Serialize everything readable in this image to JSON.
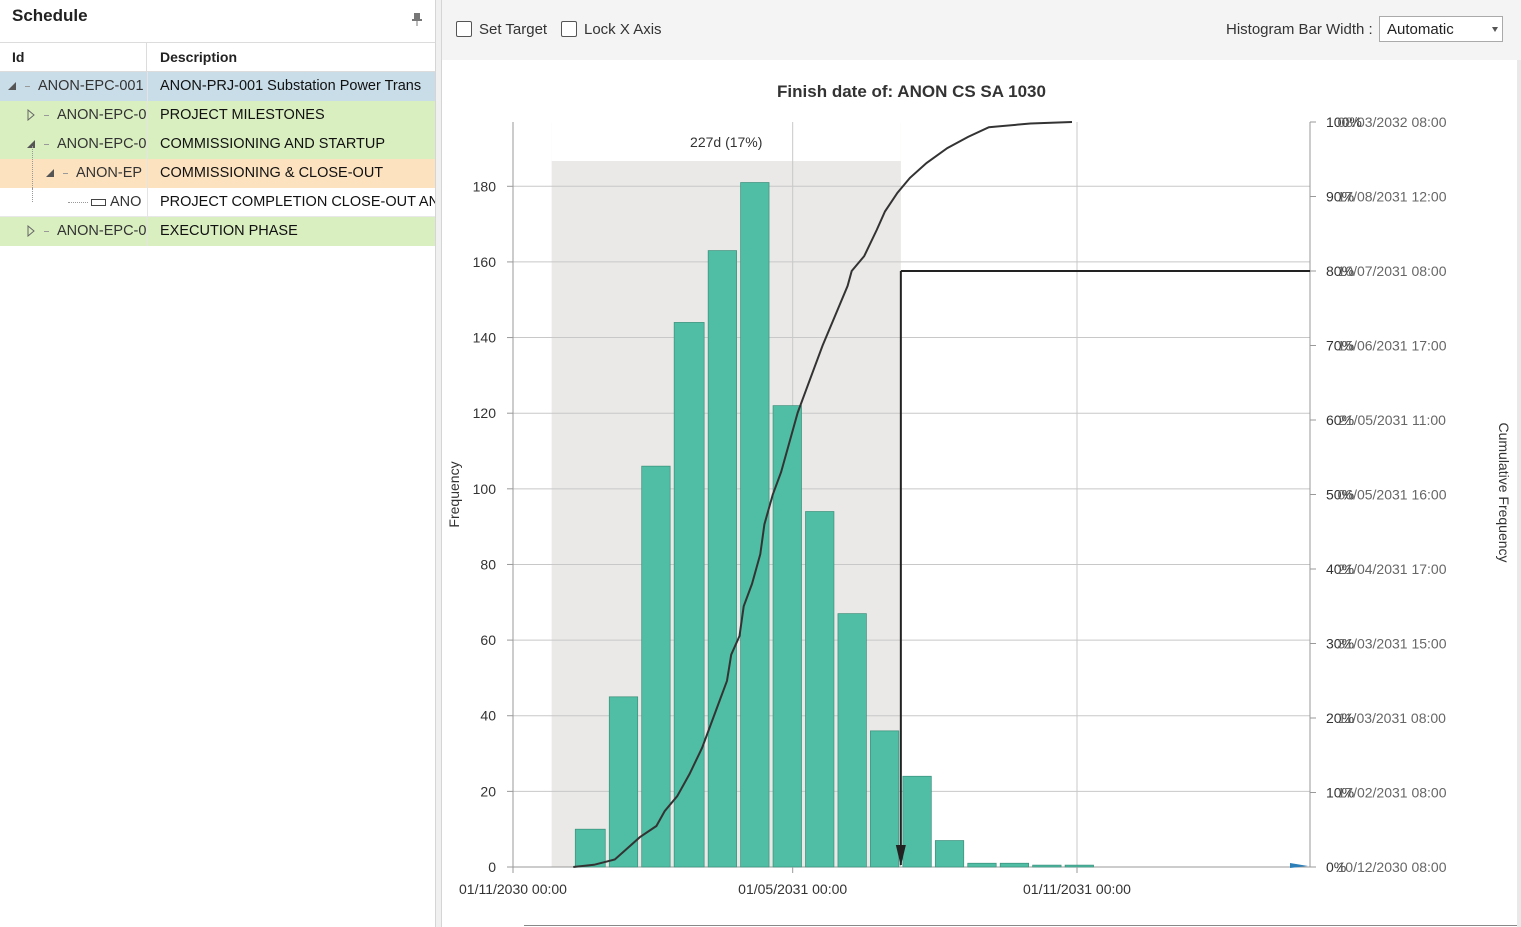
{
  "schedule": {
    "title": "Schedule",
    "pin_icon": "pin-icon",
    "columns": {
      "id": "Id",
      "description": "Description"
    },
    "rows": [
      {
        "id": "ANON-EPC-001",
        "description": "ANON-PRJ-001 Substation Power Trans",
        "level": 0,
        "state": "expanded",
        "color": "#c9dde8"
      },
      {
        "id": "ANON-EPC-0",
        "description": "PROJECT MILESTONES",
        "level": 1,
        "state": "collapsed",
        "color": "#d9efc0"
      },
      {
        "id": "ANON-EPC-0",
        "description": "COMMISSIONING AND STARTUP",
        "level": 1,
        "state": "expanded",
        "color": "#d9efc0"
      },
      {
        "id": "ANON-EP",
        "description": "COMMISSIONING & CLOSE-OUT",
        "level": 2,
        "state": "expanded",
        "color": "#fde2c0"
      },
      {
        "id": "ANO",
        "description": "PROJECT COMPLETION CLOSE-OUT AN",
        "level": 3,
        "state": "leaf",
        "color": "#ffffff"
      },
      {
        "id": "ANON-EPC-0",
        "description": "EXECUTION PHASE",
        "level": 1,
        "state": "collapsed",
        "color": "#d9efc0"
      }
    ]
  },
  "toolbar": {
    "set_target_label": "Set Target",
    "set_target_checked": false,
    "lock_x_label": "Lock X Axis",
    "lock_x_checked": false,
    "histogram_bar_width_label": "Histogram Bar Width :",
    "histogram_bar_width_value": "Automatic"
  },
  "chart_data": {
    "type": "bar",
    "title": "Finish date of: ANON CS SA 1030",
    "ylabel": "Frequency",
    "y2label": "Cumulative Frequency",
    "ylim": [
      0,
      197
    ],
    "y_ticks": [
      0,
      20,
      40,
      60,
      80,
      100,
      120,
      140,
      160,
      180
    ],
    "x_tick_labels": [
      "01/11/2030 00:00",
      "01/05/2031 00:00",
      "01/11/2031 00:00"
    ],
    "x_tick_positions": [
      "2030-11-01",
      "2031-05-01",
      "2031-11-01"
    ],
    "colors": {
      "bar": "#4fbea4",
      "bar_stroke": "#3a8f7a",
      "highlight_region": "#ebe9e7",
      "curve": "#333333",
      "grid": "#c8c8c8"
    },
    "bins": [
      {
        "start": "2030-12-10",
        "end": "2030-12-31",
        "frequency": 10
      },
      {
        "start": "2031-01-01",
        "end": "2031-01-21",
        "frequency": 45
      },
      {
        "start": "2031-01-22",
        "end": "2031-02-11",
        "frequency": 106
      },
      {
        "start": "2031-02-12",
        "end": "2031-03-05",
        "frequency": 144
      },
      {
        "start": "2031-03-06",
        "end": "2031-03-26",
        "frequency": 163
      },
      {
        "start": "2031-03-27",
        "end": "2031-04-16",
        "frequency": 181
      },
      {
        "start": "2031-04-17",
        "end": "2031-05-07",
        "frequency": 122
      },
      {
        "start": "2031-05-08",
        "end": "2031-05-28",
        "frequency": 94
      },
      {
        "start": "2031-05-29",
        "end": "2031-06-18",
        "frequency": 67
      },
      {
        "start": "2031-06-19",
        "end": "2031-07-09",
        "frequency": 36
      },
      {
        "start": "2031-07-10",
        "end": "2031-07-30",
        "frequency": 24
      },
      {
        "start": "2031-07-31",
        "end": "2031-08-20",
        "frequency": 7
      },
      {
        "start": "2031-08-21",
        "end": "2031-09-10",
        "frequency": 1
      },
      {
        "start": "2031-09-11",
        "end": "2031-10-01",
        "frequency": 1
      },
      {
        "start": "2031-10-02",
        "end": "2031-10-22",
        "frequency": 0.5
      },
      {
        "start": "2031-10-23",
        "end": "2031-11-12",
        "frequency": 0.5
      }
    ],
    "cumulative_axis": [
      {
        "percent": "0%",
        "date": "10/12/2030 08:00"
      },
      {
        "percent": "10%",
        "date": "17/02/2031 08:00"
      },
      {
        "percent": "20%",
        "date": "11/03/2031 08:00"
      },
      {
        "percent": "30%",
        "date": "31/03/2031 15:00"
      },
      {
        "percent": "40%",
        "date": "21/04/2031 17:00"
      },
      {
        "percent": "50%",
        "date": "06/05/2031 16:00"
      },
      {
        "percent": "60%",
        "date": "21/05/2031 11:00"
      },
      {
        "percent": "70%",
        "date": "15/06/2031 17:00"
      },
      {
        "percent": "80%",
        "date": "10/07/2031 08:00"
      },
      {
        "percent": "90%",
        "date": "17/08/2031 12:00"
      },
      {
        "percent": "100%",
        "date": "08/03/2032 08:00"
      }
    ],
    "cumulative_curve": [
      [
        0,
        0
      ],
      [
        0.05,
        0.3
      ],
      [
        0.1,
        1.0
      ],
      [
        0.13,
        2.5
      ],
      [
        0.16,
        4.0
      ],
      [
        0.2,
        5.5
      ],
      [
        0.22,
        7.5
      ],
      [
        0.25,
        9.5
      ],
      [
        0.28,
        12.5
      ],
      [
        0.31,
        16.0
      ],
      [
        0.33,
        19.0
      ],
      [
        0.35,
        22.0
      ],
      [
        0.37,
        25.0
      ],
      [
        0.38,
        28.5
      ],
      [
        0.4,
        31.0
      ],
      [
        0.41,
        35.0
      ],
      [
        0.43,
        38.0
      ],
      [
        0.45,
        42.0
      ],
      [
        0.46,
        46.0
      ],
      [
        0.48,
        50.0
      ],
      [
        0.5,
        53.0
      ],
      [
        0.52,
        57.0
      ],
      [
        0.54,
        61.0
      ],
      [
        0.56,
        64.0
      ],
      [
        0.58,
        67.0
      ],
      [
        0.6,
        70.0
      ],
      [
        0.63,
        74.0
      ],
      [
        0.66,
        78.0
      ],
      [
        0.67,
        80.0
      ],
      [
        0.7,
        82.0
      ],
      [
        0.73,
        85.5
      ],
      [
        0.75,
        88.0
      ],
      [
        0.78,
        90.5
      ],
      [
        0.81,
        92.5
      ],
      [
        0.85,
        94.5
      ],
      [
        0.9,
        96.5
      ],
      [
        0.95,
        98.0
      ],
      [
        1.0,
        99.3
      ],
      [
        1.1,
        99.8
      ],
      [
        1.2,
        100.0
      ]
    ],
    "highlight": {
      "label": "227d (17%)",
      "range": [
        "2030-11-26",
        "2031-07-10"
      ]
    },
    "target": {
      "percent": 80,
      "date": "10/07/2031 08:00"
    }
  }
}
